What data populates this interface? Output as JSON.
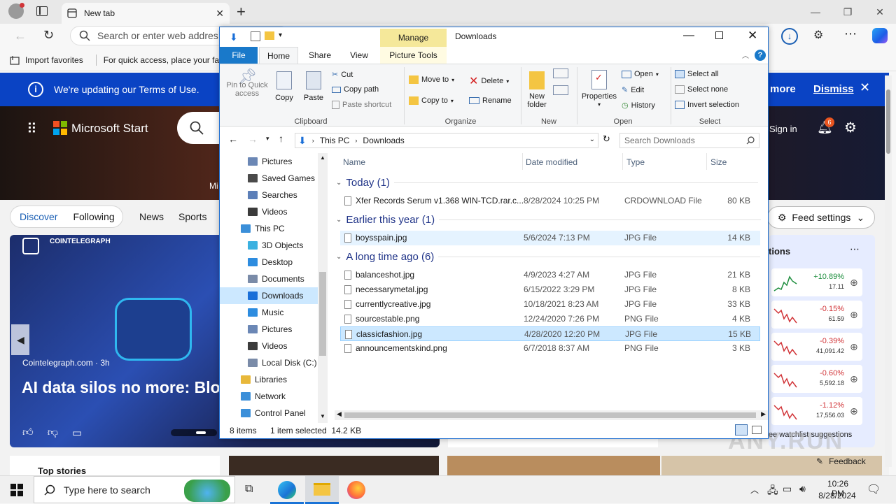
{
  "browser": {
    "tab_title": "New tab",
    "address_placeholder": "Search or enter web addres",
    "favorites": {
      "import": "Import favorites",
      "hint": "For quick access, place your favo"
    },
    "notice": {
      "message": "We're updating our Terms of Use.",
      "more": "more",
      "dismiss": "Dismiss"
    }
  },
  "msn": {
    "brand": "Microsoft Start",
    "hero_caption": "Mi",
    "sign_in": "Sign in",
    "notif_count": "6",
    "tabs": {
      "discover": "Discover",
      "following": "Following",
      "news": "News",
      "sports": "Sports"
    },
    "feed_settings": "Feed settings",
    "card": {
      "source_tag": "COINTELEGRAPH",
      "source": "Cointelegraph.com · 3h",
      "headline": "AI data silos no more: Blo take back privacy"
    },
    "top_stories": "Top stories",
    "watchlist": {
      "title": "tions",
      "suggestions": "ee watchlist suggestions",
      "stocks": [
        {
          "pct": "+10.89%",
          "val": "17.11",
          "trend": "up"
        },
        {
          "pct": "-0.15%",
          "val": "61.59",
          "trend": "down"
        },
        {
          "pct": "-0.39%",
          "val": "41,091.42",
          "trend": "down"
        },
        {
          "pct": "-0.60%",
          "val": "5,592.18",
          "trend": "down"
        },
        {
          "pct": "-1.12%",
          "val": "17,556.03",
          "trend": "down"
        }
      ]
    },
    "feedback": "Feedback"
  },
  "explorer": {
    "title": "Downloads",
    "manage": "Manage",
    "tabs": {
      "file": "File",
      "home": "Home",
      "share": "Share",
      "view": "View",
      "picture_tools": "Picture Tools"
    },
    "ribbon": {
      "pin": "Pin to Quick access",
      "copy": "Copy",
      "paste": "Paste",
      "cut": "Cut",
      "copy_path": "Copy path",
      "paste_shortcut": "Paste shortcut",
      "move_to": "Move to",
      "copy_to": "Copy to",
      "delete": "Delete",
      "rename": "Rename",
      "new_folder": "New folder",
      "properties": "Properties",
      "open": "Open",
      "edit": "Edit",
      "history": "History",
      "select_all": "Select all",
      "select_none": "Select none",
      "invert": "Invert selection",
      "groups": {
        "clipboard": "Clipboard",
        "organize": "Organize",
        "new": "New",
        "open": "Open",
        "select": "Select"
      }
    },
    "path": {
      "this_pc": "This PC",
      "downloads": "Downloads"
    },
    "search_placeholder": "Search Downloads",
    "nav": [
      "Pictures",
      "Saved Games",
      "Searches",
      "Videos",
      "This PC",
      "3D Objects",
      "Desktop",
      "Documents",
      "Downloads",
      "Music",
      "Pictures",
      "Videos",
      "Local Disk (C:)",
      "Libraries",
      "Network",
      "Control Panel"
    ],
    "columns": {
      "name": "Name",
      "date": "Date modified",
      "type": "Type",
      "size": "Size"
    },
    "groups": {
      "today": "Today (1)",
      "earlier": "Earlier this year (1)",
      "long_ago": "A long time ago (6)"
    },
    "files": [
      {
        "name": "Xfer Records Serum v1.368 WIN-TCD.rar.c...",
        "date": "8/28/2024 10:25 PM",
        "type": "CRDOWNLOAD File",
        "size": "80 KB"
      },
      {
        "name": "boysspain.jpg",
        "date": "5/6/2024 7:13 PM",
        "type": "JPG File",
        "size": "14 KB"
      },
      {
        "name": "balanceshot.jpg",
        "date": "4/9/2023 4:27 AM",
        "type": "JPG File",
        "size": "21 KB"
      },
      {
        "name": "necessarymetal.jpg",
        "date": "6/15/2022 3:29 PM",
        "type": "JPG File",
        "size": "8 KB"
      },
      {
        "name": "currentlycreative.jpg",
        "date": "10/18/2021 8:23 AM",
        "type": "JPG File",
        "size": "33 KB"
      },
      {
        "name": "sourcestable.png",
        "date": "12/24/2020 7:26 PM",
        "type": "PNG File",
        "size": "4 KB"
      },
      {
        "name": "classicfashion.jpg",
        "date": "4/28/2020 12:20 PM",
        "type": "JPG File",
        "size": "15 KB"
      },
      {
        "name": "announcementskind.png",
        "date": "6/7/2018 8:37 AM",
        "type": "PNG File",
        "size": "3 KB"
      }
    ],
    "status": {
      "items": "8 items",
      "selected": "1 item selected  14.2 KB"
    }
  },
  "taskbar": {
    "search_placeholder": "Type here to search",
    "time": "10:26 PM",
    "date": "8/28/2024"
  },
  "watermark": "ANY.RUN"
}
